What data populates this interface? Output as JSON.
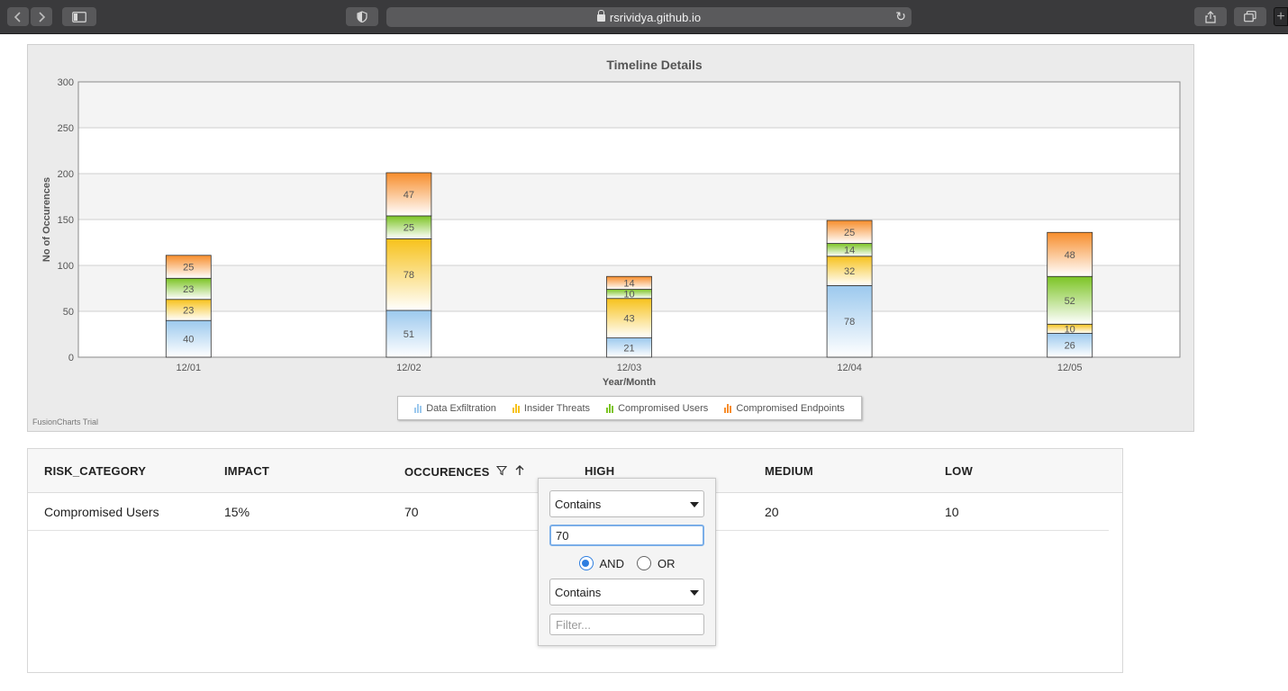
{
  "browser": {
    "url": "rsrividya.github.io",
    "back_icon": "chevron-left-icon",
    "forward_icon": "chevron-right-icon",
    "sidebar_icon": "sidebar-icon",
    "privacy_icon": "shield-icon",
    "reload_icon": "reload-icon",
    "share_icon": "share-icon",
    "tabs_icon": "tabs-icon",
    "new_tab_label": "+"
  },
  "chart_data": {
    "type": "bar",
    "stacked": true,
    "title": "Timeline Details",
    "xlabel": "Year/Month",
    "ylabel": "No of Occurences",
    "ylim": [
      0,
      300
    ],
    "yticks": [
      0,
      50,
      100,
      150,
      200,
      250,
      300
    ],
    "categories": [
      "12/01",
      "12/02",
      "12/03",
      "12/04",
      "12/05"
    ],
    "series": [
      {
        "name": "Data Exfiltration",
        "values": [
          40,
          51,
          21,
          78,
          26
        ],
        "color": "#9cc9ee"
      },
      {
        "name": "Insider Threats",
        "values": [
          23,
          78,
          43,
          32,
          10
        ],
        "color": "#f7c21b"
      },
      {
        "name": "Compromised Users",
        "values": [
          23,
          25,
          10,
          14,
          52
        ],
        "color": "#7cc424"
      },
      {
        "name": "Compromised Endpoints",
        "values": [
          25,
          47,
          14,
          25,
          48
        ],
        "color": "#f78d2b"
      }
    ],
    "legend_position": "bottom",
    "grid": true,
    "watermark": "FusionCharts Trial"
  },
  "grid": {
    "columns": [
      "RISK_CATEGORY",
      "IMPACT",
      "OCCURENCES",
      "HIGH",
      "MEDIUM",
      "LOW"
    ],
    "occurences_filter_icon": "filter-icon",
    "occurences_sort_icon": "arrow-up-icon",
    "rows": [
      {
        "risk_category": "Compromised Users",
        "impact": "15%",
        "occurences": "70",
        "high": "",
        "medium": "20",
        "low": "10"
      }
    ]
  },
  "filter": {
    "condition1": "Contains",
    "value1": "70",
    "operator_and": "AND",
    "operator_or": "OR",
    "selected_operator": "AND",
    "condition2": "Contains",
    "value2_placeholder": "Filter..."
  }
}
